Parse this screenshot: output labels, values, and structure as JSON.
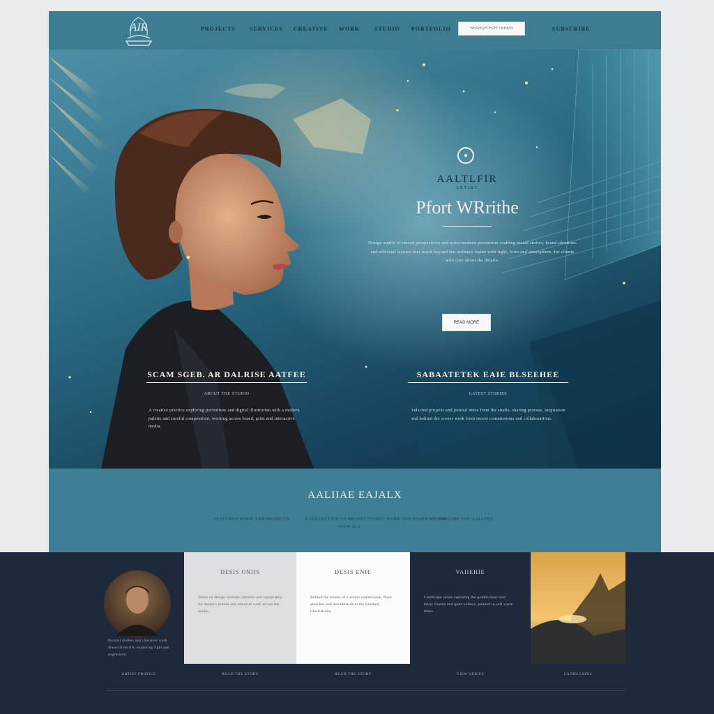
{
  "nav": {
    "logo_text": "AIR",
    "links": [
      "PROJECTS",
      "SERVICES",
      "CREATIVE",
      "WORK",
      "STUDIO",
      "PORTFOLIO"
    ],
    "search_placeholder": "SEARCH FOR TERMS",
    "contact": "SUBSCRIBE"
  },
  "hero": {
    "kicker": "AALTLFIR",
    "kicker_sub": "ARTIST",
    "title": "Pfort WRrithe",
    "body": "Design studio of mixed perspectives and quiet modern portraiture crafting visual stories, brand identities and editorial layouts that reach beyond the ordinary frame with light, form and atmosphere, for clients who care about the details.",
    "cta": "READ MORE",
    "left_col": {
      "title": "SCAM SGEB. AR DALRISE AATFEE",
      "sub": "ABOUT THE STUDIO",
      "body": "A creative practice exploring portraiture and digital illustration with a modern palette and careful composition, working across brand, print and interactive media."
    },
    "right_col": {
      "title": "SABAATETEK EAIE BLSEEHEE",
      "sub": "LATEST STORIES",
      "body": "Selected projects and journal notes from the studio, sharing process, inspiration and behind the scenes work from recent commissions and collaborations."
    }
  },
  "band": {
    "title": "AALIIAE EAJALX",
    "meta_left": "FEATURED WORK AND PROJECTS",
    "meta_center": "A COLLECTION OF RECENT STUDIO WORK AND EXPERIMENTS",
    "meta_center_2": "VIEW ALL",
    "meta_right": "EXPLORE THE GALLERY"
  },
  "cards": [
    {
      "title": "",
      "body": "Portrait studies and character work drawn from life, exploring light and expression.",
      "foot": "ARTIST PROFILE"
    },
    {
      "title": "DESIS ONIIS",
      "body": "Notes on design systems, identity and typography for modern brands and editorial work across the studio.",
      "foot": "READ THE STORY"
    },
    {
      "title": "DESIS ENIE",
      "body": "Behind the scenes of a recent commission, from sketches and moodboards to the finished illustrations.",
      "foot": "READ THE STORY"
    },
    {
      "title": "VAIIEHIE",
      "body": "Landscape series capturing the golden hour over misty forests and quiet valleys, painted in soft warm tones.",
      "foot": "VIEW SERIES"
    },
    {
      "title": "",
      "body": "",
      "foot": "LANDSCAPES"
    }
  ],
  "colors": {
    "nav": "#3e7c92",
    "band": "#3f7f95",
    "dark": "#1e293a",
    "accent": "#f2ece0"
  }
}
